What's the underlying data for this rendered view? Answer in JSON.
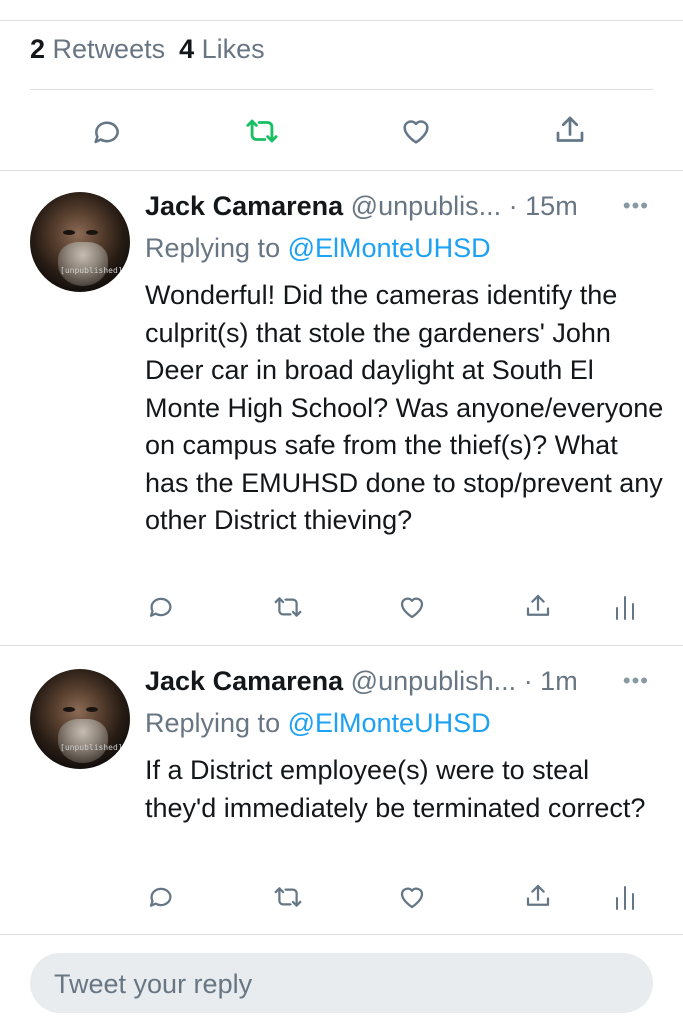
{
  "stats": {
    "retweets_count": "2",
    "retweets_label": "Retweets",
    "likes_count": "4",
    "likes_label": "Likes"
  },
  "main_actions": {
    "reply_icon": "reply-icon",
    "retweet_icon": "retweet-icon",
    "like_icon": "heart-icon",
    "share_icon": "share-icon",
    "retweet_active_color": "#17bf63"
  },
  "replies": [
    {
      "name": "Jack Camarena",
      "handle": "@unpublis...",
      "time": "· 15m",
      "replying_prefix": "Replying to",
      "replying_to": "@ElMonteUHSD",
      "text": "Wonderful! Did the cameras identify the culprit(s) that stole the gardeners' John Deer car in broad daylight at South El Monte High School? Was anyone/everyone on campus safe from the thief(s)? What has the EMUHSD done to stop/prevent any other District thieving?",
      "avatar_watermark": "[unpublished]"
    },
    {
      "name": "Jack Camarena",
      "handle": "@unpublish...",
      "time": "· 1m",
      "replying_prefix": "Replying to",
      "replying_to": "@ElMonteUHSD",
      "text": "If a District employee(s) were to steal they'd immediately be terminated correct?",
      "avatar_watermark": "[unpublished]"
    }
  ],
  "reply_box": {
    "placeholder": "Tweet your reply"
  },
  "colors": {
    "link": "#1da1f2",
    "muted": "#687684",
    "icon": "#657786"
  }
}
